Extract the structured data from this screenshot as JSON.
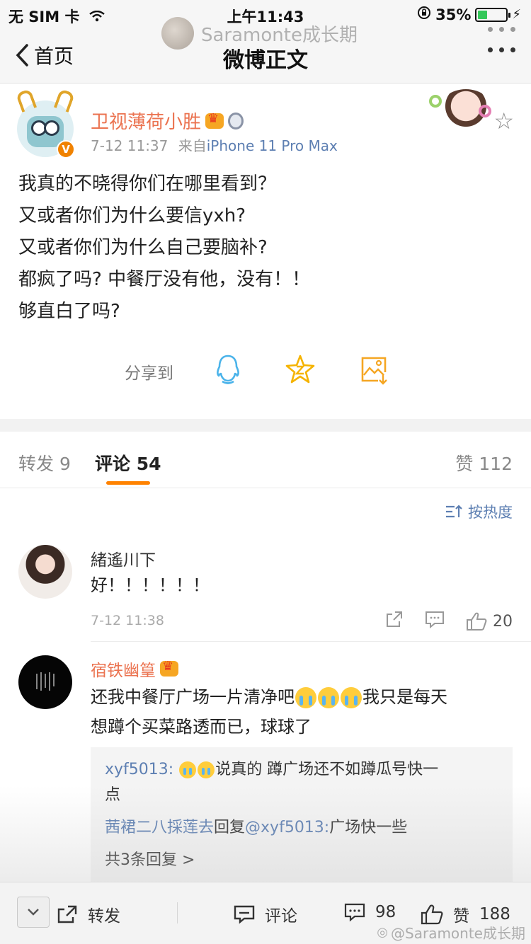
{
  "status": {
    "carrier": "无 SIM 卡",
    "time": "上午11:43",
    "battery": "35%",
    "battery_level": 0.35
  },
  "watermark": {
    "name": "Saramonte成长期",
    "bottom": "@Saramonte成长期"
  },
  "nav": {
    "back_label": "首页",
    "title": "微博正文"
  },
  "post": {
    "author": "卫视薄荷小胜",
    "time": "7-12 11:37",
    "source_prefix": "来自",
    "source": "iPhone 11 Pro Max",
    "verified_badge": "V",
    "lines": [
      "我真的不晓得你们在哪里看到？",
      "又或者你们为什么要信yxh?",
      "又或者你们为什么自己要脑补?",
      "都疯了吗? 中餐厅没有他，没有！！",
      "够直白了吗?"
    ],
    "share_label": "分享到",
    "share_icons": [
      "qq-icon",
      "favorite-star-icon",
      "save-image-icon"
    ]
  },
  "tabs": {
    "repost": "转发 9",
    "comments": "评论 54",
    "likes": "赞 112"
  },
  "sort_label": "按热度",
  "comments": [
    {
      "name": "緒遙川下",
      "text": "好！！！！！！",
      "time": "7-12 11:38",
      "likes": "20"
    },
    {
      "name": "宿铁幽篁",
      "text_a": "还我中餐厅广场一片清净吧",
      "text_b": "我只是每天",
      "text_c": "想蹲个买菜路透而已，球球了",
      "replies": {
        "r1_user": "xyf5013:",
        "r1_text_a": "说真的 蹲广场还不如蹲瓜号快一",
        "r1_text_b": "点",
        "r2_user": "茜裙二八採莲去",
        "r2_mid": "回复",
        "r2_target": "@xyf5013:",
        "r2_text": "广场快一些",
        "more": "共3条回复 >"
      }
    }
  ],
  "bottom": {
    "repost": "转发",
    "comment": "评论",
    "comment_count": "98",
    "like": "赞",
    "like_count": "188"
  }
}
